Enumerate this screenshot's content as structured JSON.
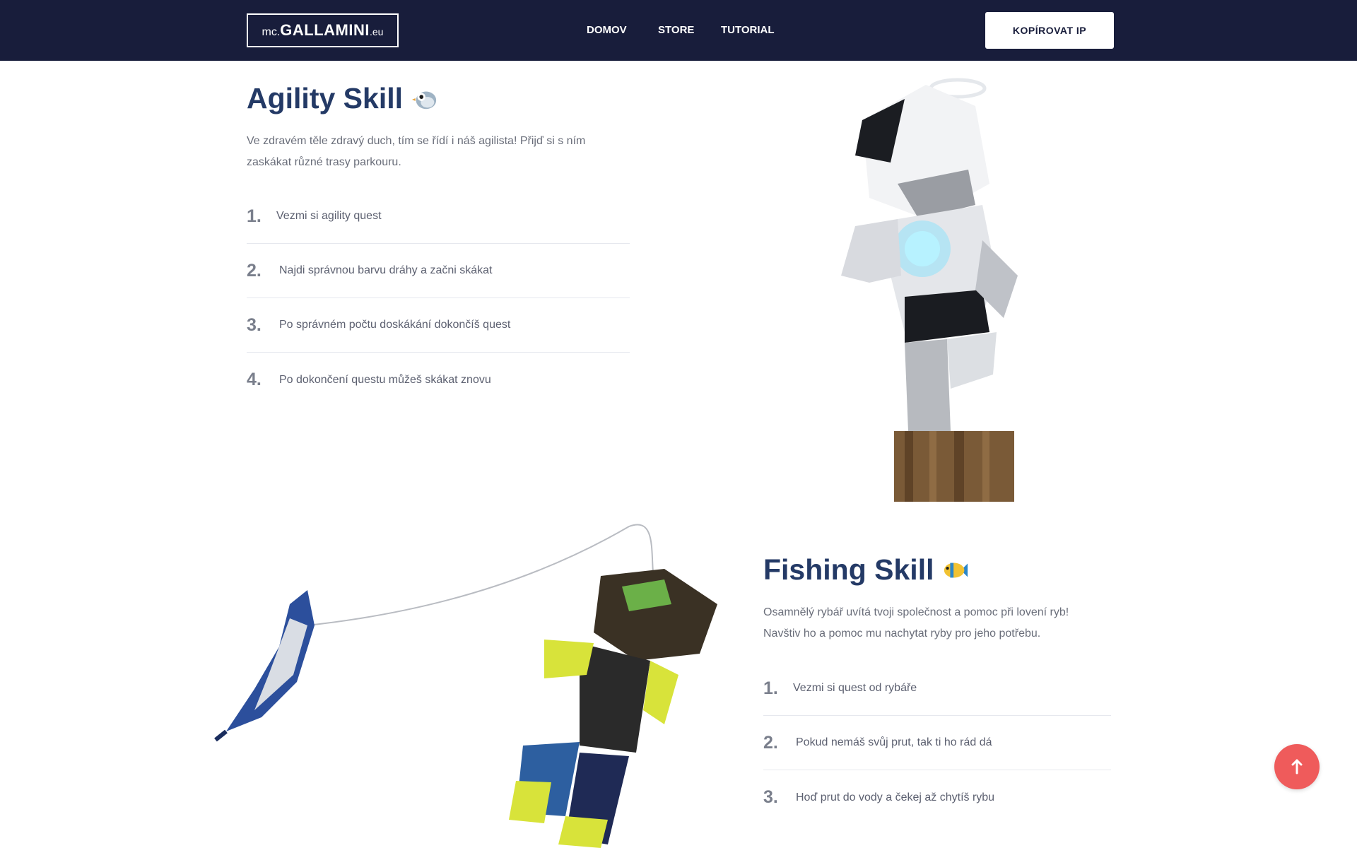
{
  "header": {
    "logo": {
      "pre": "mc.",
      "main": "GALLAMINI",
      "post": ".eu"
    },
    "nav": [
      {
        "label": "DOMOV"
      },
      {
        "label": "STORE"
      },
      {
        "label": "TUTORIAL"
      }
    ],
    "copy_ip_label": "KOPÍROVAT IP"
  },
  "agility": {
    "title": "Agility Skill",
    "emoji_icon": "bird-icon",
    "description_line1": "Ve zdravém těle zdravý duch, tím se řídí i náš agilista! Přijď si s ním",
    "description_line2": "zaskákat různé trasy parkouru.",
    "steps": [
      {
        "num": "1.",
        "text": "Vezmi si agility quest"
      },
      {
        "num": "2.",
        "text": "Najdi správnou barvu dráhy a začni skákat"
      },
      {
        "num": "3.",
        "text": "Po správném počtu doskákání dokončíš quest"
      },
      {
        "num": "4.",
        "text": "Po dokončení questu můžeš skákat znovu"
      }
    ]
  },
  "fishing": {
    "title": "Fishing Skill",
    "emoji_icon": "fish-icon",
    "description_line1": "Osamnělý rybář uvítá tvoji společnost a pomoc při lovení ryb!",
    "description_line2": "Navštiv ho a pomoc mu nachytat ryby pro jeho potřebu.",
    "steps": [
      {
        "num": "1.",
        "text": "Vezmi si quest od rybáře"
      },
      {
        "num": "2.",
        "text": "Pokud nemáš svůj prut, tak ti ho rád dá"
      },
      {
        "num": "3.",
        "text": "Hoď prut do vody a čekej až chytíš rybu"
      }
    ]
  },
  "colors": {
    "header_bg": "#181d3b",
    "title": "#243a66",
    "scroll_top_bg": "#ef5b5b"
  },
  "scroll_top_icon": "arrow-up-icon"
}
